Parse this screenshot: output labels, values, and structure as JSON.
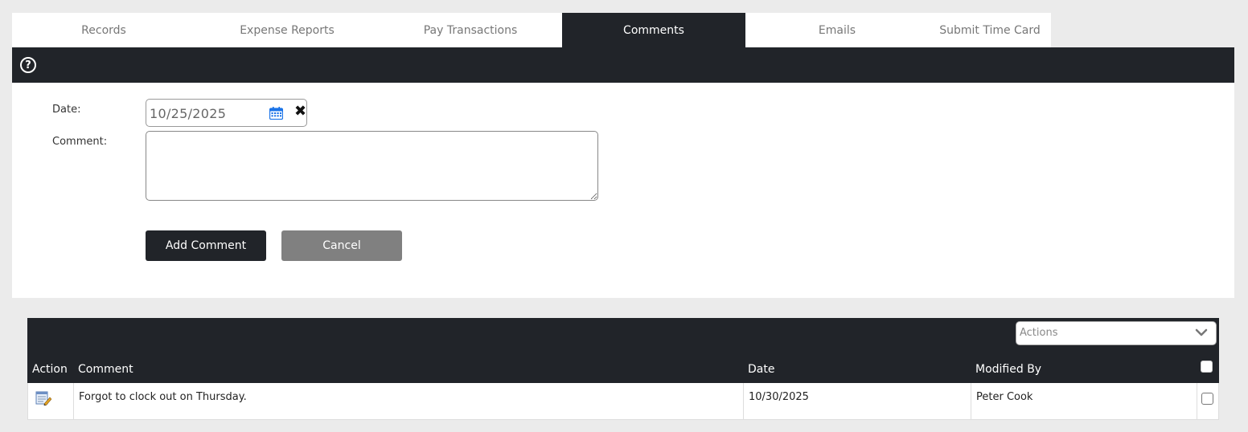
{
  "tabs": [
    {
      "label": "Records"
    },
    {
      "label": "Expense Reports"
    },
    {
      "label": "Pay Transactions"
    },
    {
      "label": "Comments"
    },
    {
      "label": "Emails"
    },
    {
      "label": "Submit Time Card"
    }
  ],
  "active_tab": "Comments",
  "form": {
    "date_label": "Date:",
    "date_value": "10/25/2025",
    "comment_label": "Comment:",
    "comment_value": "",
    "add_button": "Add Comment",
    "cancel_button": "Cancel"
  },
  "grid": {
    "actions_placeholder": "Actions",
    "columns": {
      "action": "Action",
      "comment": "Comment",
      "date": "Date",
      "modified_by": "Modified By"
    },
    "rows": [
      {
        "comment": "Forgot to clock out on Thursday.",
        "date": "10/30/2025",
        "modified_by": "Peter Cook",
        "checked": false
      }
    ]
  },
  "colors": {
    "dark": "#212429",
    "cancel": "#808080",
    "calendar": "#1a73e8"
  },
  "icons": {
    "help": "question-circle-icon",
    "calendar": "calendar-icon",
    "clear": "close-icon",
    "edit": "edit-note-icon",
    "dropdown": "chevron-down-icon"
  }
}
